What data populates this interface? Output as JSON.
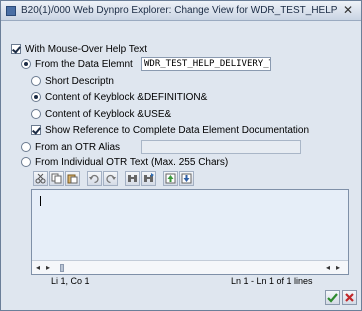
{
  "window": {
    "title": "B20(1)/000 Web Dynpro Explorer: Change View for WDR_TEST_HELP",
    "close_glyph": "✕"
  },
  "options": {
    "mouse_over_label": "With Mouse-Over Help Text",
    "mouse_over_checked": true,
    "from_data_element_label": "From the Data Elemnt",
    "data_element_value": "WDR_TEST_HELP_DELIVERY_T",
    "short_descr_label": "Short Descriptn",
    "keyblock_def_label": "Content of Keyblock &DEFINITION&",
    "keyblock_use_label": "Content of Keyblock &USE&",
    "show_reference_label": "Show Reference to Complete Data Element Documentation",
    "show_reference_checked": true,
    "from_otr_alias_label": "From an OTR Alias",
    "otr_alias_value": "",
    "from_individual_otr_label": "From Individual OTR Text (Max. 255 Chars)"
  },
  "editor": {
    "text": "",
    "status_left": "Li 1, Co 1",
    "status_right": "Ln 1 - Ln 1 of 1 lines",
    "scroll_left": "◂",
    "scroll_right": "▸"
  },
  "toolbar_icons": [
    "cut-icon",
    "copy-icon",
    "paste-icon",
    "undo-icon",
    "redo-icon",
    "find-icon",
    "find-next-icon",
    "upload-icon",
    "download-icon"
  ],
  "colors": {
    "background": "#dfe6ef",
    "editor_background": "#e6eef8",
    "confirm_green": "#2e8b2e",
    "cancel_red": "#c0282a"
  }
}
